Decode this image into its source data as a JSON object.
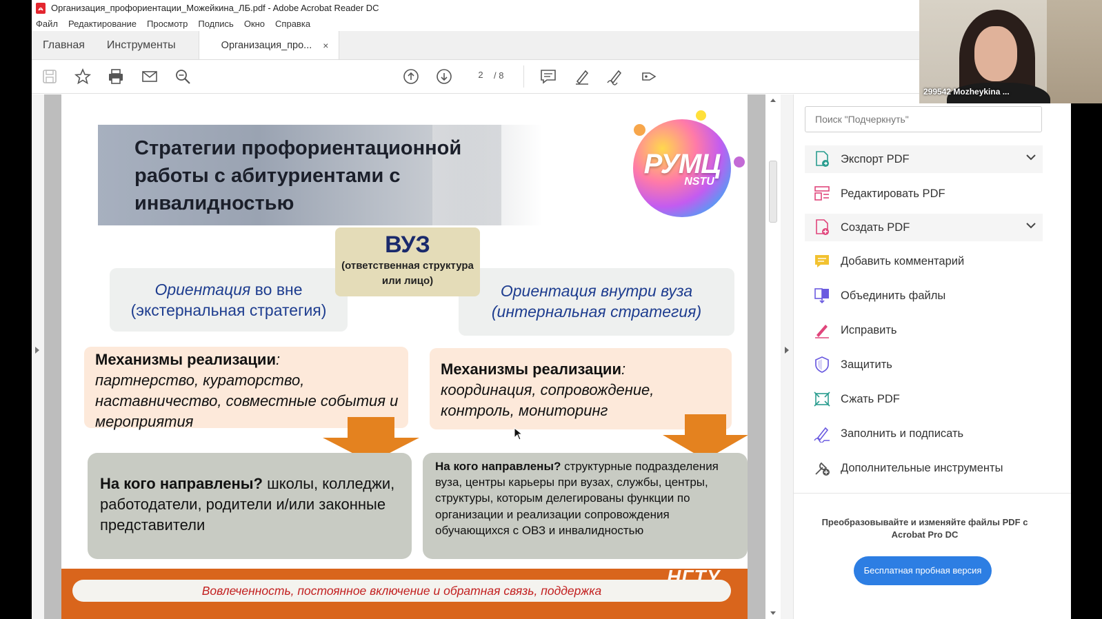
{
  "window": {
    "title": "Организация_профориентации_Можейкина_ЛБ.pdf - Adobe Acrobat Reader DC"
  },
  "menu": [
    "Файл",
    "Редактирование",
    "Просмотр",
    "Подпись",
    "Окно",
    "Справка"
  ],
  "tabs": {
    "home": "Главная",
    "tools": "Инструменты",
    "document": "Организация_про...",
    "close": "×"
  },
  "toolbar": {
    "current_page": "2",
    "total_pages": "/ 8"
  },
  "slide": {
    "title": "Стратегии профориентационной работы с абитуриентами с инвалидностью",
    "logo_main": "РУМЦ",
    "logo_sub": "NSTU",
    "vuz_heading": "ВУЗ",
    "vuz_sub": "(ответственная структура или лицо)",
    "external": {
      "word": "Ориентация",
      "rest": " во вне",
      "line2": "(экстернальная стратегия)"
    },
    "internal": {
      "line1": "Ориентация внутри вуза",
      "line2": "(интернальная стратегия)"
    },
    "mech_left": {
      "label": "Механизмы реализации",
      "colon": ":",
      "text": "партнерство, кураторство, наставничество, совместные события и мероприятия"
    },
    "mech_right": {
      "label": "Механизмы реализации",
      "colon": ":",
      "text": "координация, сопровождение, контроль, мониторинг"
    },
    "target_left": {
      "q": "На кого направлены?",
      "text": " школы, колледжи, работодатели, родители и/или законные представители"
    },
    "target_right": {
      "q": "На кого направлены?",
      "text": " структурные подразделения вуза, центры карьеры при вузах, службы, центры, структуры, которым делегированы функции по организации и реализации сопровождения обучающихся с ОВЗ и инвалидностью"
    },
    "footer": "Вовлеченность, постоянное включение и обратная связь, поддержка",
    "footer_logo": "НГТУ"
  },
  "right_panel": {
    "search_placeholder": "Поиск \"Подчеркнуть\"",
    "tools": [
      {
        "label": "Экспорт PDF",
        "icon": "export-pdf-icon"
      },
      {
        "label": "Редактировать PDF",
        "icon": "edit-pdf-icon"
      },
      {
        "label": "Создать PDF",
        "icon": "create-pdf-icon"
      },
      {
        "label": "Добавить комментарий",
        "icon": "comment-icon"
      },
      {
        "label": "Объединить файлы",
        "icon": "combine-files-icon"
      },
      {
        "label": "Исправить",
        "icon": "fix-icon"
      },
      {
        "label": "Защитить",
        "icon": "shield-icon"
      },
      {
        "label": "Сжать PDF",
        "icon": "compress-pdf-icon"
      },
      {
        "label": "Заполнить и подписать",
        "icon": "fill-sign-icon"
      },
      {
        "label": "Дополнительные инструменты",
        "icon": "more-tools-icon"
      }
    ],
    "promo": "Преобразовывайте и изменяйте файлы PDF с Acrobat Pro DC",
    "trial_button": "Бесплатная пробная версия"
  },
  "webcam": {
    "label": "299542 Mozheykina ..."
  },
  "colors": {
    "accent_blue": "#2d7ee3",
    "footer_orange": "#d9651c",
    "footer_text": "#c21f1f",
    "title_navy": "#1a2a6c"
  }
}
